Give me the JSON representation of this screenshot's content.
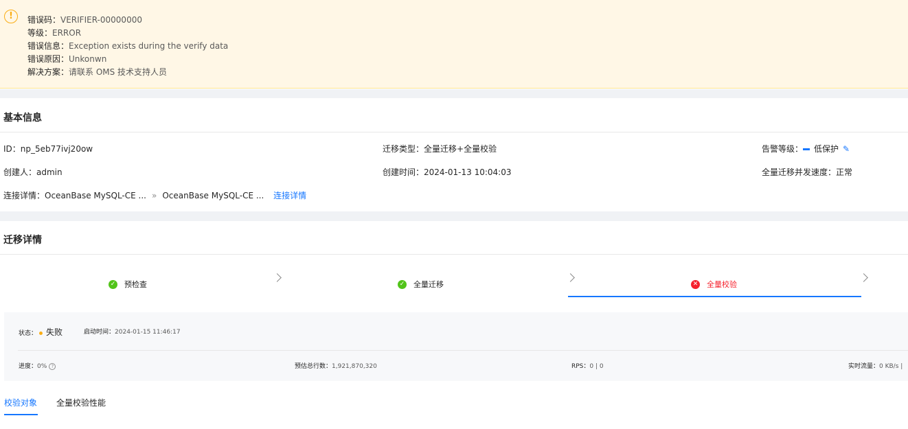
{
  "alert": {
    "icon": "exclamation-circle-icon",
    "lines": [
      {
        "key": "错误码：",
        "value": "VERIFIER-00000000"
      },
      {
        "key": "等级：",
        "value": "ERROR"
      },
      {
        "key": "错误信息：",
        "value": "Exception exists during the verify data"
      },
      {
        "key": "错误原因：",
        "value": "Unkonwn"
      },
      {
        "key": "解决方案：",
        "value": "请联系 OMS 技术支持人员"
      }
    ]
  },
  "basic_info": {
    "title": "基本信息",
    "id_label": "ID：",
    "id_value": "np_5eb77ivj20ow",
    "type_label": "迁移类型：",
    "type_value": "全量迁移+全量校验",
    "alarm_label": "告警等级：",
    "alarm_value": "低保护",
    "creator_label": "创建人：",
    "creator_value": "admin",
    "created_label": "创建时间：",
    "created_value": "2024-01-13 10:04:03",
    "speed_label": "全量迁移并发速度：",
    "speed_value": "正常",
    "conn_label": "连接详情：",
    "conn_source": "OceanBase MySQL-CE ...",
    "conn_separator": "»",
    "conn_target": "OceanBase MySQL-CE ...",
    "conn_link": "连接详情"
  },
  "migration": {
    "title": "迁移详情",
    "steps": [
      {
        "label": "预检查",
        "status": "ok"
      },
      {
        "label": "全量迁移",
        "status": "ok"
      },
      {
        "label": "全量校验",
        "status": "error"
      }
    ],
    "status_label": "状态：",
    "status_value": "失败",
    "start_label": "启动时间：",
    "start_value": "2024-01-15 11:46:17",
    "progress_label": "进度：",
    "progress_value": "0%",
    "rows_label": "预估总行数：",
    "rows_value": "1,921,870,320",
    "rps_label": "RPS：",
    "rps_value": "0 | 0",
    "traffic_label": "实时流量：",
    "traffic_value": "0 KB/s |"
  },
  "tabs": [
    {
      "label": "校验对象",
      "active": true
    },
    {
      "label": "全量校验性能",
      "active": false
    }
  ]
}
